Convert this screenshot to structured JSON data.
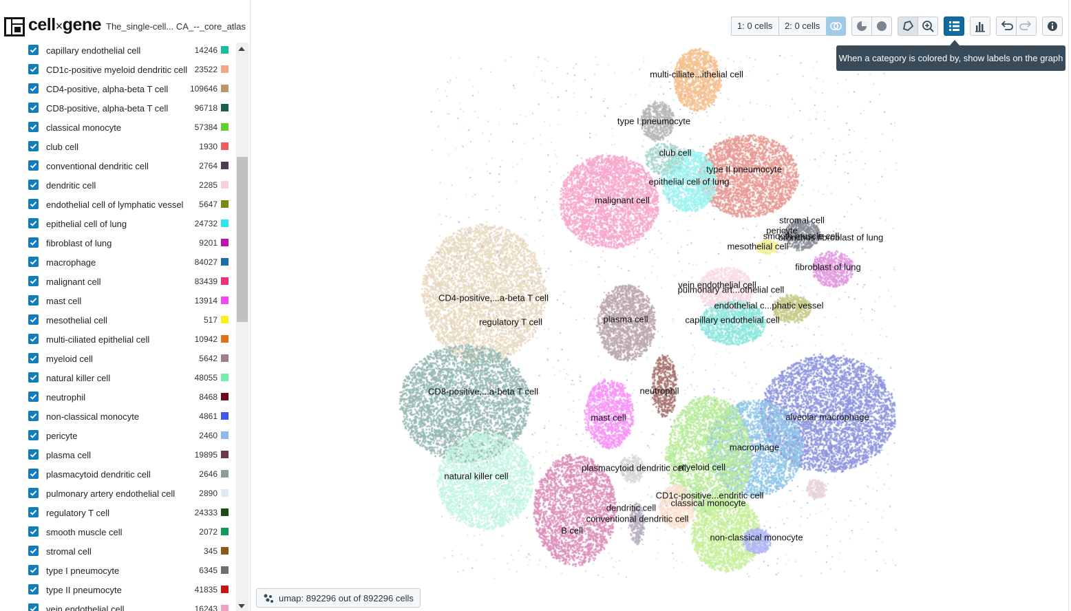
{
  "app": {
    "logo_main": "cell",
    "logo_x": "×",
    "logo_gene": "gene",
    "dataset_title": "The_single-cell... CA_--_core_atlas"
  },
  "categories": [
    {
      "label": "capillary endothelial cell",
      "count": "14246",
      "color": "#1abc9c"
    },
    {
      "label": "CD1c-positive myeloid dendritic cell",
      "count": "23522",
      "color": "#f4a582"
    },
    {
      "label": "CD4-positive, alpha-beta T cell",
      "count": "109646",
      "color": "#b89a6a"
    },
    {
      "label": "CD8-positive, alpha-beta T cell",
      "count": "96718",
      "color": "#1b5e50"
    },
    {
      "label": "classical monocyte",
      "count": "57384",
      "color": "#5fd130"
    },
    {
      "label": "club cell",
      "count": "1930",
      "color": "#f35a5a"
    },
    {
      "label": "conventional dendritic cell",
      "count": "2764",
      "color": "#4b3b55"
    },
    {
      "label": "dendritic cell",
      "count": "2285",
      "color": "#f8cfe0"
    },
    {
      "label": "endothelial cell of lymphatic vessel",
      "count": "5647",
      "color": "#7a8a14"
    },
    {
      "label": "epithelial cell of lung",
      "count": "24732",
      "color": "#30e5f0"
    },
    {
      "label": "fibroblast of lung",
      "count": "9201",
      "color": "#c010b0"
    },
    {
      "label": "macrophage",
      "count": "84027",
      "color": "#1a6fa8"
    },
    {
      "label": "malignant cell",
      "count": "83439",
      "color": "#f0307a"
    },
    {
      "label": "mast cell",
      "count": "13914",
      "color": "#f844f2"
    },
    {
      "label": "mesothelial cell",
      "count": "517",
      "color": "#f8f21a"
    },
    {
      "label": "multi-ciliated epithelial cell",
      "count": "10942",
      "color": "#e0701a"
    },
    {
      "label": "myeloid cell",
      "count": "5642",
      "color": "#9e8088"
    },
    {
      "label": "natural killer cell",
      "count": "48055",
      "color": "#6ef0a8"
    },
    {
      "label": "neutrophil",
      "count": "8468",
      "color": "#6e0b16"
    },
    {
      "label": "non-classical monocyte",
      "count": "4861",
      "color": "#3a5af0"
    },
    {
      "label": "pericyte",
      "count": "2460",
      "color": "#90b6ef"
    },
    {
      "label": "plasma cell",
      "count": "19895",
      "color": "#6e3848"
    },
    {
      "label": "plasmacytoid dendritic cell",
      "count": "2646",
      "color": "#8a9e96"
    },
    {
      "label": "pulmonary artery endothelial cell",
      "count": "2890",
      "color": "#dceaf8"
    },
    {
      "label": "regulatory T cell",
      "count": "24333",
      "color": "#1c4a14"
    },
    {
      "label": "smooth muscle cell",
      "count": "2072",
      "color": "#0f9a5a"
    },
    {
      "label": "stromal cell",
      "count": "345",
      "color": "#8a5a14"
    },
    {
      "label": "type I pneumocyte",
      "count": "6345",
      "color": "#6e6e6e"
    },
    {
      "label": "type II pneumocyte",
      "count": "41835",
      "color": "#c81414"
    },
    {
      "label": "vein endothelial cell",
      "count": "16243",
      "color": "#f0a0c0"
    }
  ],
  "toolbar": {
    "cellset1": "1: 0 cells",
    "cellset2": "2: 0 cells"
  },
  "tooltip": "When a category is colored by, show labels on the graph",
  "footer": {
    "embedding_info": "umap: 892296 out of 892296 cells"
  },
  "cluster_labels": [
    "multi-ciliate...ithelial cell",
    "type I pneumocyte",
    "club cell",
    "type II pneumocyte",
    "epithelial cell of lung",
    "malignant cell",
    "stromal cell",
    "pericyte",
    "smooth muscle cell",
    "bronchus fibroblast of lung",
    "mesothelial cell",
    "fibroblast of lung",
    "vein endothelial cell",
    "pulmonary art...othelial cell",
    "CD4-positive,...a-beta T cell",
    "endothelial c...phatic vessel",
    "regulatory T cell",
    "plasma cell",
    "capillary endothelial cell",
    "neutrophil",
    "CD8-positive,...a-beta T cell",
    "mast cell",
    "alveolar macrophage",
    "macrophage",
    "plasmacytoid dendritic cell",
    "myeloid cell",
    "natural killer cell",
    "CD1c-positive...endritic cell",
    "classical monocyte",
    "dendritic cell",
    "conventional dendritic cell",
    "B cell",
    "non-classical monocyte"
  ]
}
